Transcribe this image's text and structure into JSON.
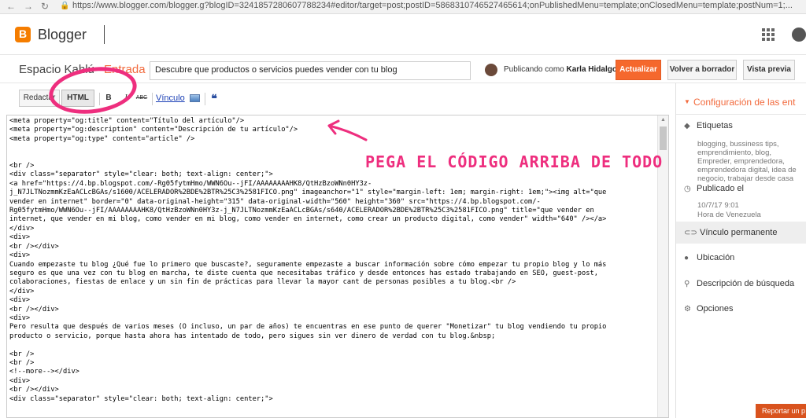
{
  "browser": {
    "url": "https://www.blogger.com/blogger.g?blogID=3241857280607788234#editor/target=post;postID=5868310746527465614;onPublishedMenu=template;onClosedMenu=template;postNum=1;..."
  },
  "header": {
    "brand": "Blogger"
  },
  "postbar": {
    "blog_name": "Espacio Kahlú",
    "section": "Entrada",
    "title_value": "Descubre que productos o servicios puedes vender con tu blog",
    "publishing_as_prefix": "Publicando como",
    "publishing_as_user": "Karla Hidalgo",
    "update_label": "Actualizar",
    "revert_label": "Volver a borrador",
    "preview_label": "Vista previa"
  },
  "toolbar": {
    "compose_label": "Redactar",
    "html_label": "HTML",
    "bold_label": "B",
    "italic_label": "I",
    "strike_label": "ABC",
    "link_label": "Vínculo",
    "quote_label": "❝"
  },
  "annotation": "PEGA EL CÓDIGO ARRIBA DE TODO",
  "editor": {
    "lines": [
      "<meta property=\"og:title\" content=\"Título del artículo\"/>",
      "<meta property=\"og:description\" content=\"Descripción de tu artículo\"/>",
      "<meta property=\"og:type\" content=\"article\" />",
      "",
      "",
      "<br />",
      "<div class=\"separator\" style=\"clear: both; text-align: center;\">",
      "<a href=\"https://4.bp.blogspot.com/-Rg05fytmHmo/WWN6Ou--jFI/AAAAAAAAHK8/QtHzBzoWNn0HY3z-",
      "j_N7JLTNozmmKzEaACLcBGAs/s1600/ACELERADOR%2BDE%2BTR%25C3%2581FICO.png\" imageanchor=\"1\" style=\"margin-left: 1em; margin-right: 1em;\"><img alt=\"que",
      "vender en internet\" border=\"0\" data-original-height=\"315\" data-original-width=\"560\" height=\"360\" src=\"https://4.bp.blogspot.com/-",
      "Rg05fytmHmo/WWN6Ou--jFI/AAAAAAAAHK8/QtHzBzoWNn0HY3z-j_N7JLTNozmmKzEaACLcBGAs/s640/ACELERADOR%2BDE%2BTR%25C3%2581FICO.png\" title=\"que vender en",
      "internet, que vender en mi blog, como vender en mi blog, como vender en internet, como crear un producto digital, como vender\" width=\"640\" /></a>",
      "</div>",
      "<div>",
      "<br /></div>",
      "<div>",
      "Cuando empezaste tu blog ¿Qué fue lo primero que buscaste?, seguramente empezaste a buscar información sobre cómo empezar tu propio blog y lo más",
      "seguro es que una vez con tu blog en marcha, te diste cuenta que necesitabas tráfico y desde entonces has estado trabajando en SEO, guest-post,",
      "colaboraciones, fiestas de enlace y un sin fin de prácticas para llevar la mayor cant de personas posibles a tu blog.<br />",
      "</div>",
      "<div>",
      "<br /></div>",
      "<div>",
      "Pero resulta que después de varios meses (O incluso, un par de años) te encuentras en ese punto de querer \"Monetizar\" tu blog vendiendo tu propio",
      "producto o servicio, porque hasta ahora has intentado de todo, pero sigues sin ver dinero de verdad con tu blog.&nbsp;",
      "",
      "<br />",
      "<br />",
      "<!--more--></div>",
      "<div>",
      "<br /></div>",
      "<div class=\"separator\" style=\"clear: both; text-align: center;\">"
    ]
  },
  "sidebar": {
    "header": "Configuración de las ent",
    "labels_title": "Etiquetas",
    "labels_value": "blogging, bussiness tips, emprendimiento, blog, Empreder, emprendedora, emprendedora digital, idea de negocio, trabajar desde casa",
    "published_title": "Publicado el",
    "published_date": "10/7/17 9:01",
    "published_tz": "Hora de Venezuela",
    "permalink_title": "Vínculo permanente",
    "location_title": "Ubicación",
    "search_desc_title": "Descripción de búsqueda",
    "options_title": "Opciones",
    "report_label": "Reportar un p"
  }
}
